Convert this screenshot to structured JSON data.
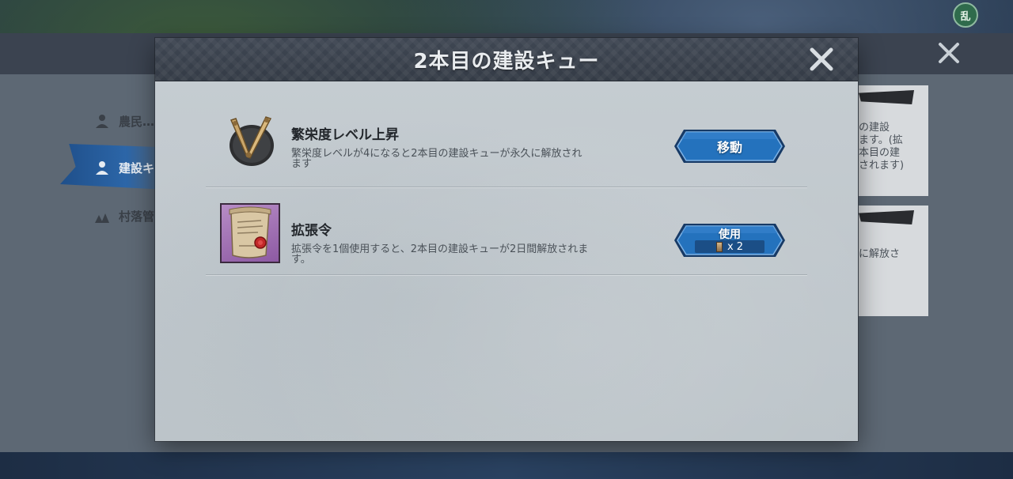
{
  "background": {
    "badge": "乱",
    "sidebar": [
      {
        "label": "農民…",
        "icon": "peasant-icon"
      },
      {
        "label": "建設キ",
        "icon": "builder-icon"
      },
      {
        "label": "村落管",
        "icon": "village-icon"
      }
    ],
    "card1_text": "の建設\nます。(拡\n本目の建\nされます)",
    "card2_text": "に解放さ"
  },
  "modal": {
    "title": "2本目の建設キュー",
    "close_icon": "close-icon"
  },
  "options": [
    {
      "icon": "prosperity-emblem-icon",
      "title": "繁栄度レベル上昇",
      "description": "繁栄度レベルが4になると2本目の建設キューが永久に解放されます",
      "button_label": "移動"
    },
    {
      "icon": "expansion-decree-scroll-icon",
      "title": "拡張令",
      "description": "拡張令を1個使用すると、2本目の建設キューが2日間解放されます。",
      "button_label": "使用",
      "cost_icon": "expansion-decree-small-icon",
      "cost": "x 2"
    }
  ],
  "colors": {
    "header_bg": "#3a414c",
    "panel_bg": "#c2c9ce",
    "button_blue": "#1f67b2"
  }
}
